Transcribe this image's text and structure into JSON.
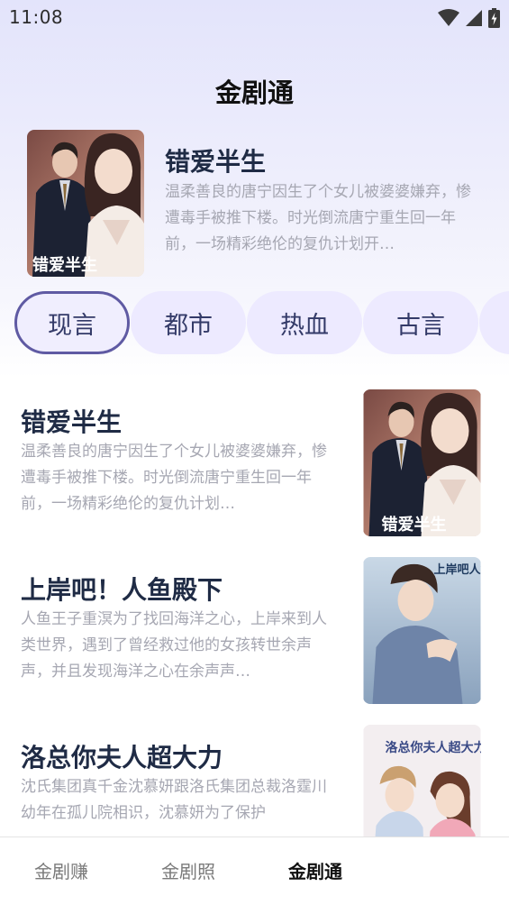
{
  "status_bar": {
    "time": "11:08",
    "icons": [
      "wifi-icon",
      "signal-icon",
      "battery-charging-icon"
    ]
  },
  "header": {
    "title": "金剧通"
  },
  "featured": {
    "title": "错爱半生",
    "description": "温柔善良的唐宁因生了个女儿被婆婆嫌弃，惨遭毒手被推下楼。时光倒流唐宁重生回一年前，一场精彩绝伦的复仇计划开…",
    "cover_text": "错爱半生"
  },
  "genres": {
    "items": [
      "现言",
      "都市",
      "热血",
      "古言"
    ],
    "active_index": 0
  },
  "dramas": [
    {
      "title": "错爱半生",
      "description": "温柔善良的唐宁因生了个女儿被婆婆嫌弃，惨遭毒手被推下楼。时光倒流唐宁重生回一年前，一场精彩绝伦的复仇计划…",
      "cover_text": "错爱半生"
    },
    {
      "title": "上岸吧！人鱼殿下",
      "description": "人鱼王子重溟为了找回海洋之心，上岸来到人类世界，遇到了曾经救过他的女孩转世余声声，并且发现海洋之心在余声声…",
      "cover_text": "上岸吧人鱼殿下"
    },
    {
      "title": "洛总你夫人超大力",
      "description": "沈氏集团真千金沈慕妍跟洛氏集团总裁洛霆川幼年在孤儿院相识，沈慕妍为了保护",
      "cover_text": "洛总你夫人超大力"
    }
  ],
  "bottom_nav": {
    "items": [
      "金剧赚",
      "金剧照",
      "金剧通"
    ],
    "active_index": 2
  },
  "colors": {
    "title_text": "#1f2b45",
    "desc_text": "#a6a7b2",
    "tab_bg": "#edeaff",
    "tab_active_border": "#5f5aa3"
  }
}
